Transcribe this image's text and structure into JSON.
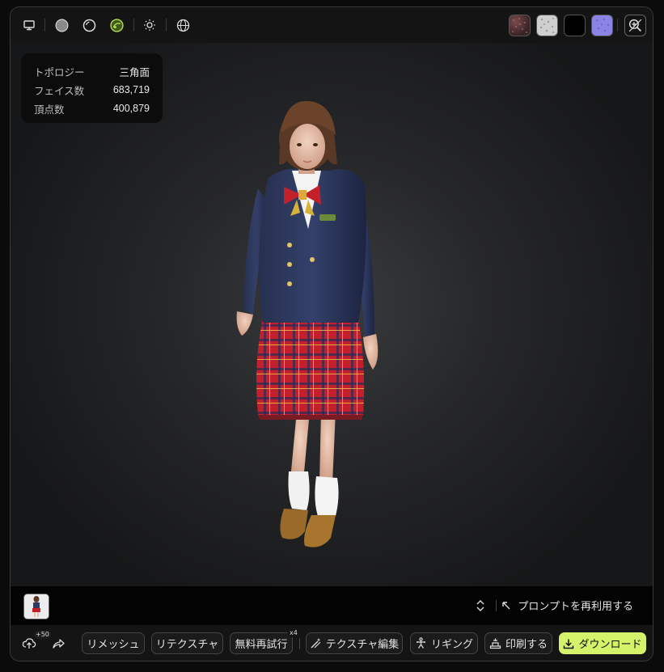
{
  "toolbar": {
    "icons": [
      "monitor-icon",
      "solid-sphere-icon",
      "outline-sphere-icon",
      "textured-sphere-icon",
      "sun-icon",
      "globe-wireframe-icon"
    ],
    "swatches": [
      "albedo-swatch",
      "roughness-swatch",
      "metallic-swatch",
      "normal-swatch"
    ],
    "swatch_colors": [
      "#5a3638",
      "#cfcfcf",
      "#000000",
      "#8a84e6"
    ],
    "accent": "#b8e04a"
  },
  "info": {
    "topology_label": "トポロジー",
    "topology_value": "三角面",
    "faces_label": "フェイス数",
    "faces_value": "683,719",
    "vertices_label": "頂点数",
    "vertices_value": "400,879"
  },
  "prompt": {
    "reuse_label": "プロンプトを再利用する"
  },
  "bottom": {
    "upload_badge": "+50",
    "remesh": "リメッシュ",
    "retexture": "リテクスチャ",
    "free_retry": "無料再試行",
    "retry_badge": "x4",
    "texture_edit": "テクスチャ編集",
    "rigging": "リギング",
    "print": "印刷する",
    "download": "ダウンロード"
  }
}
